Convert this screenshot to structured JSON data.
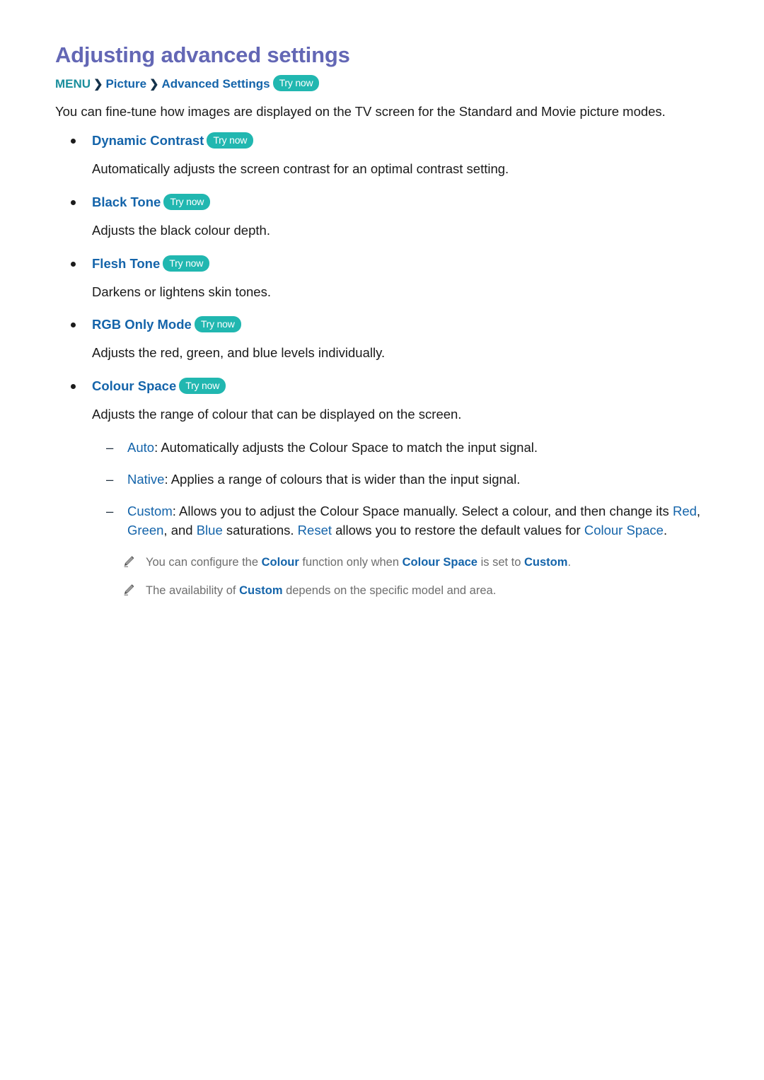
{
  "document": {
    "title": "Adjusting advanced settings",
    "breadcrumb": {
      "menu": "MENU",
      "separator": "❯",
      "path": [
        "Picture",
        "Advanced Settings"
      ],
      "try_now": "Try now"
    },
    "intro": "You can fine-tune how images are displayed on the TV screen for the Standard and Movie picture modes."
  },
  "colors": {
    "title": "#6367b5",
    "heading_blue": "#1464aa",
    "menu_teal": "#1a8e9c",
    "try_now_pill": "#21b7b0",
    "body_text": "#1a1a1a",
    "note_text": "#6e6e6e",
    "note_icon": "#8c8c8c"
  },
  "items": [
    {
      "heading": "Dynamic Contrast",
      "try_now": "Try now",
      "description": "Automatically adjusts the screen contrast for an optimal contrast setting."
    },
    {
      "heading": "Black Tone",
      "try_now": "Try now",
      "description": "Adjusts the black colour depth."
    },
    {
      "heading": "Flesh Tone",
      "try_now": "Try now",
      "description": "Darkens or lightens skin tones."
    },
    {
      "heading": "RGB Only Mode",
      "try_now": "Try now",
      "description": "Adjusts the red, green, and blue levels individually."
    },
    {
      "heading": "Colour Space",
      "try_now": "Try now",
      "description": "Adjusts the range of colour that can be displayed on the screen."
    }
  ],
  "sub_items": {
    "dash": "–",
    "auto": {
      "term": "Auto",
      "text": ": Automatically adjusts the Colour Space to match the input signal."
    },
    "native": {
      "term": "Native",
      "text": ": Applies a range of colours that is wider than the input signal."
    },
    "custom": {
      "term": "Custom",
      "part1": ": Allows you to adjust the Colour Space manually. Select a colour, and then change its ",
      "red": "Red",
      "comma1": ", ",
      "green": "Green",
      "part2": ", and ",
      "blue": "Blue",
      "part3": " saturations. ",
      "reset": "Reset",
      "part4": " allows you to restore the default values for ",
      "colour_space": "Colour Space",
      "part5": "."
    }
  },
  "notes": [
    {
      "icon": "pencil-icon",
      "part1": "You can configure the ",
      "b1": "Colour",
      "part2": " function only when ",
      "b2": "Colour Space",
      "part3": " is set to ",
      "b3": "Custom",
      "part4": "."
    },
    {
      "icon": "pencil-icon",
      "part1": "The availability of ",
      "b1": "Custom",
      "part2": " depends on the specific model and area.",
      "b2": "",
      "part3": "",
      "b3": "",
      "part4": ""
    }
  ]
}
